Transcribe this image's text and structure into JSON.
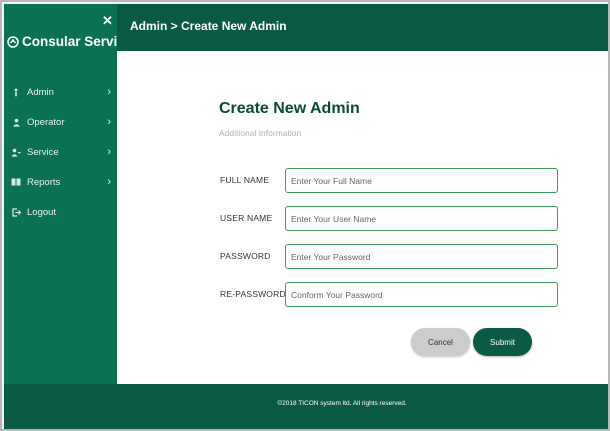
{
  "app": {
    "brand": "Consular Service",
    "close_symbol": "✕"
  },
  "sidebar": {
    "items": [
      {
        "label": "Admin",
        "icon": "person-icon",
        "has_submenu": true
      },
      {
        "label": "Operator",
        "icon": "user-icon",
        "has_submenu": true
      },
      {
        "label": "Service",
        "icon": "service-icon",
        "has_submenu": true
      },
      {
        "label": "Reports",
        "icon": "reports-icon",
        "has_submenu": true
      },
      {
        "label": "Logout",
        "icon": "logout-icon",
        "has_submenu": false
      }
    ]
  },
  "header": {
    "breadcrumb": "Admin > Create New Admin"
  },
  "form": {
    "title": "Create New Admin",
    "subtitle": "Additional Information",
    "fields": [
      {
        "label": "FULL NAME",
        "placeholder": "Enter Your Full Name",
        "value": ""
      },
      {
        "label": "USER NAME",
        "placeholder": "Enter Your User Name",
        "value": ""
      },
      {
        "label": "PASSWORD",
        "placeholder": "Enter Your Password",
        "value": ""
      },
      {
        "label": "RE-PASSWORD",
        "placeholder": "Conform Your Password",
        "value": ""
      }
    ],
    "cancel_label": "Cancel",
    "submit_label": "Submit"
  },
  "footer": {
    "copyright": "©2018 TICON system ltd. All rights reserved."
  },
  "colors": {
    "sidebar_bg": "#0b7153",
    "header_bg": "#0b5a45",
    "input_border": "#3d9a5d",
    "cancel_bg": "#cccccc"
  }
}
